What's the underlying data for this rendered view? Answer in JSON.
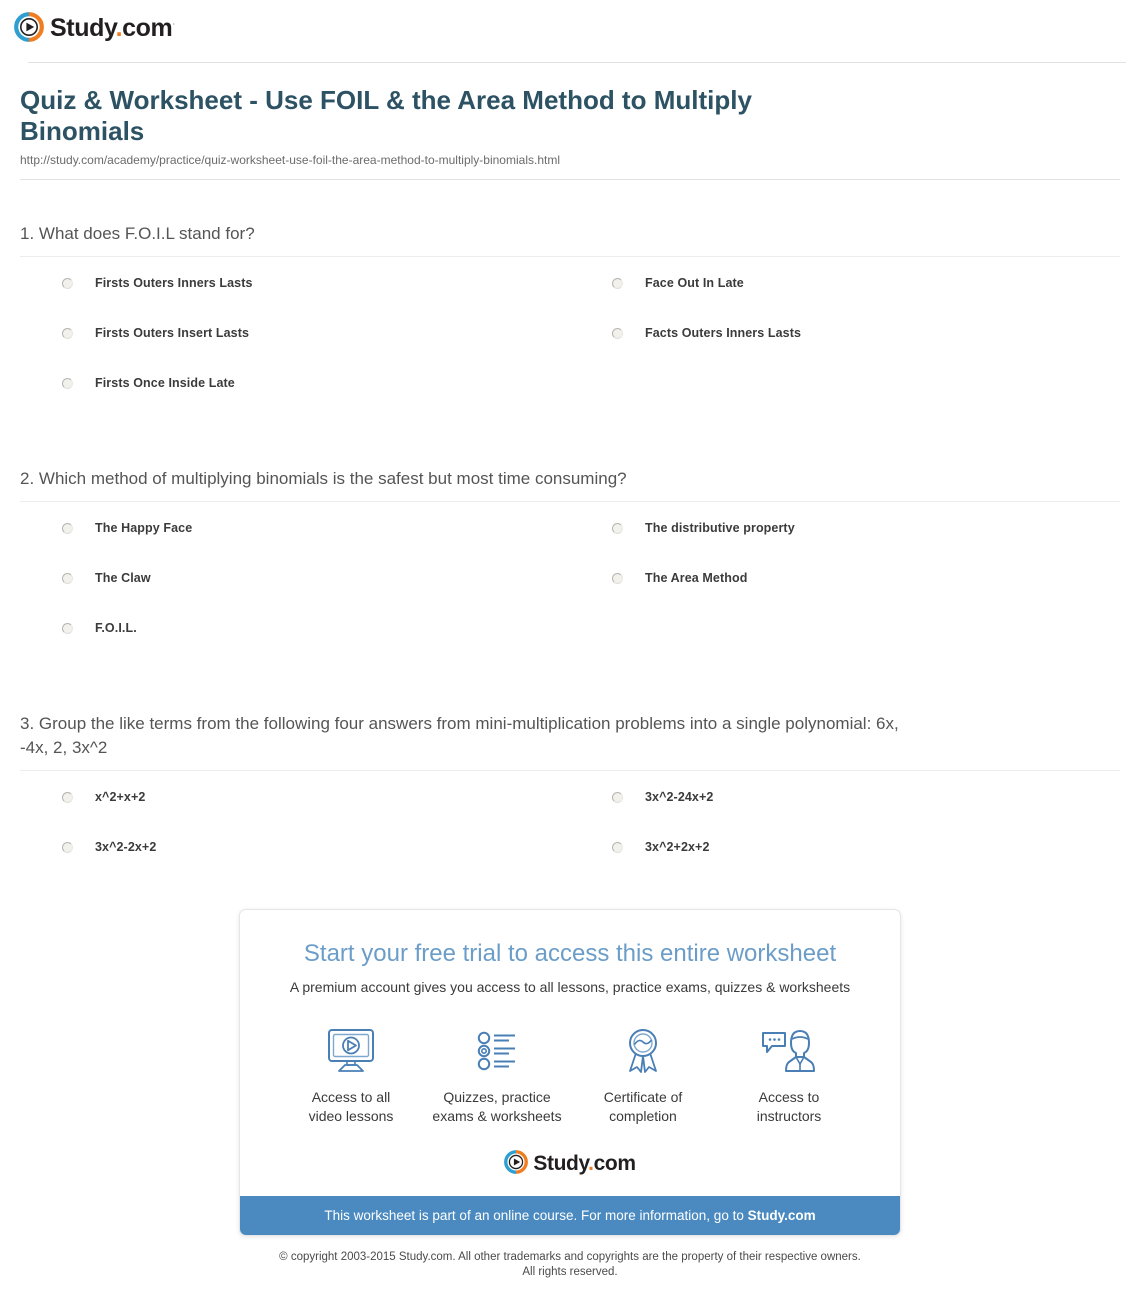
{
  "brand": {
    "name_main": "Study",
    "name_dot": ".",
    "name_tld": "com",
    "trademark": "·",
    "logo_icon": "play-circle-icon",
    "colors": {
      "orange": "#f07d22",
      "blue": "#2e9fd0",
      "bar_blue": "#4a8ac0",
      "title_teal": "#2c5264"
    }
  },
  "header": {
    "title": "Quiz & Worksheet - Use FOIL & the Area Method to Multiply Binomials",
    "url": "http://study.com/academy/practice/quiz-worksheet-use-foil-the-area-method-to-multiply-binomials.html"
  },
  "questions": [
    {
      "number": "1.",
      "text": "1. What does F.O.I.L stand for?",
      "options": [
        "Firsts Outers Inners Lasts",
        "Face Out In Late",
        "Firsts Outers Insert Lasts",
        "Facts Outers Inners Lasts",
        "Firsts Once Inside Late"
      ]
    },
    {
      "number": "2.",
      "text": "2. Which method of multiplying binomials is the safest but most time consuming?",
      "options": [
        "The Happy Face",
        "The distributive property",
        "The Claw",
        "The Area Method",
        "F.O.I.L."
      ]
    },
    {
      "number": "3.",
      "text": "3. Group the like terms from the following four answers from mini-multiplication problems into a single polynomial: 6x, -4x, 2, 3x^2",
      "options": [
        "x^2+x+2",
        "3x^2-24x+2",
        "3x^2-2x+2",
        "3x^2+2x+2"
      ]
    }
  ],
  "promo": {
    "title": "Start your free trial to access this entire worksheet",
    "subtitle": "A premium account gives you access to all lessons, practice exams, quizzes & worksheets",
    "features": [
      {
        "icon": "monitor-play-icon",
        "label_line1": "Access to all",
        "label_line2": "video lessons"
      },
      {
        "icon": "quiz-list-icon",
        "label_line1": "Quizzes, practice",
        "label_line2": "exams & worksheets"
      },
      {
        "icon": "award-ribbon-icon",
        "label_line1": "Certificate of",
        "label_line2": "completion"
      },
      {
        "icon": "instructor-chat-icon",
        "label_line1": "Access to",
        "label_line2": "instructors"
      }
    ],
    "bar_text": "This worksheet is part of an online course. For more information, go to ",
    "bar_link": "Study.com"
  },
  "footer": {
    "line1": "© copyright 2003-2015 Study.com. All other trademarks and copyrights are the property of their respective owners.",
    "line2": "All rights reserved."
  }
}
